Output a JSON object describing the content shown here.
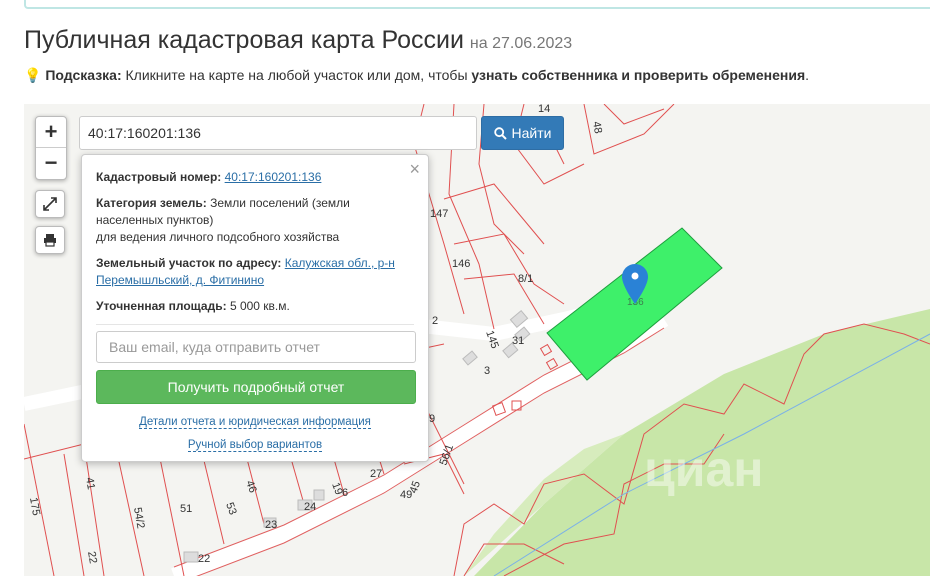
{
  "page": {
    "title": "Публичная кадастровая карта России",
    "date": "на 27.06.2023"
  },
  "hint": {
    "label": "Подсказка:",
    "text": " Кликните на карте на любой участок или дом, чтобы ",
    "bold_text": "узнать собственника и проверить обременения",
    "end": "."
  },
  "map": {
    "zoom_in": "+",
    "zoom_out": "−",
    "search_value": "40:17:160201:136",
    "search_button": "Найти",
    "parcel_color": "#3ef06a",
    "parcel_label": "136",
    "watermark": "циан",
    "labels": [
      "14",
      "48",
      "147",
      "146",
      "8/1",
      "145",
      "2",
      "3",
      "31",
      "9",
      "27",
      "56/1",
      "45",
      "49",
      "6",
      "19",
      "46",
      "53",
      "24",
      "23",
      "51",
      "54/2",
      "41",
      "175",
      "22",
      "22"
    ]
  },
  "popup": {
    "close": "×",
    "cadastral_label": "Кадастровый номер:",
    "cadastral_value": "40:17:160201:136",
    "category_label": "Категория земель:",
    "category_value": "Земли поселений (земли населенных пунктов)",
    "category_use": "для ведения личного подсобного хозяйства",
    "address_label": "Земельный участок по адресу:",
    "address_value": "Калужская обл., р-н Перемышльский, д. Фитинино",
    "area_label": "Уточненная площадь:",
    "area_value": "5 000 кв.м.",
    "email_placeholder": "Ваш email, куда отправить отчет",
    "report_button": "Получить подробный отчет",
    "details_link": "Детали отчета и юридическая информация",
    "manual_link": "Ручной выбор вариантов"
  }
}
